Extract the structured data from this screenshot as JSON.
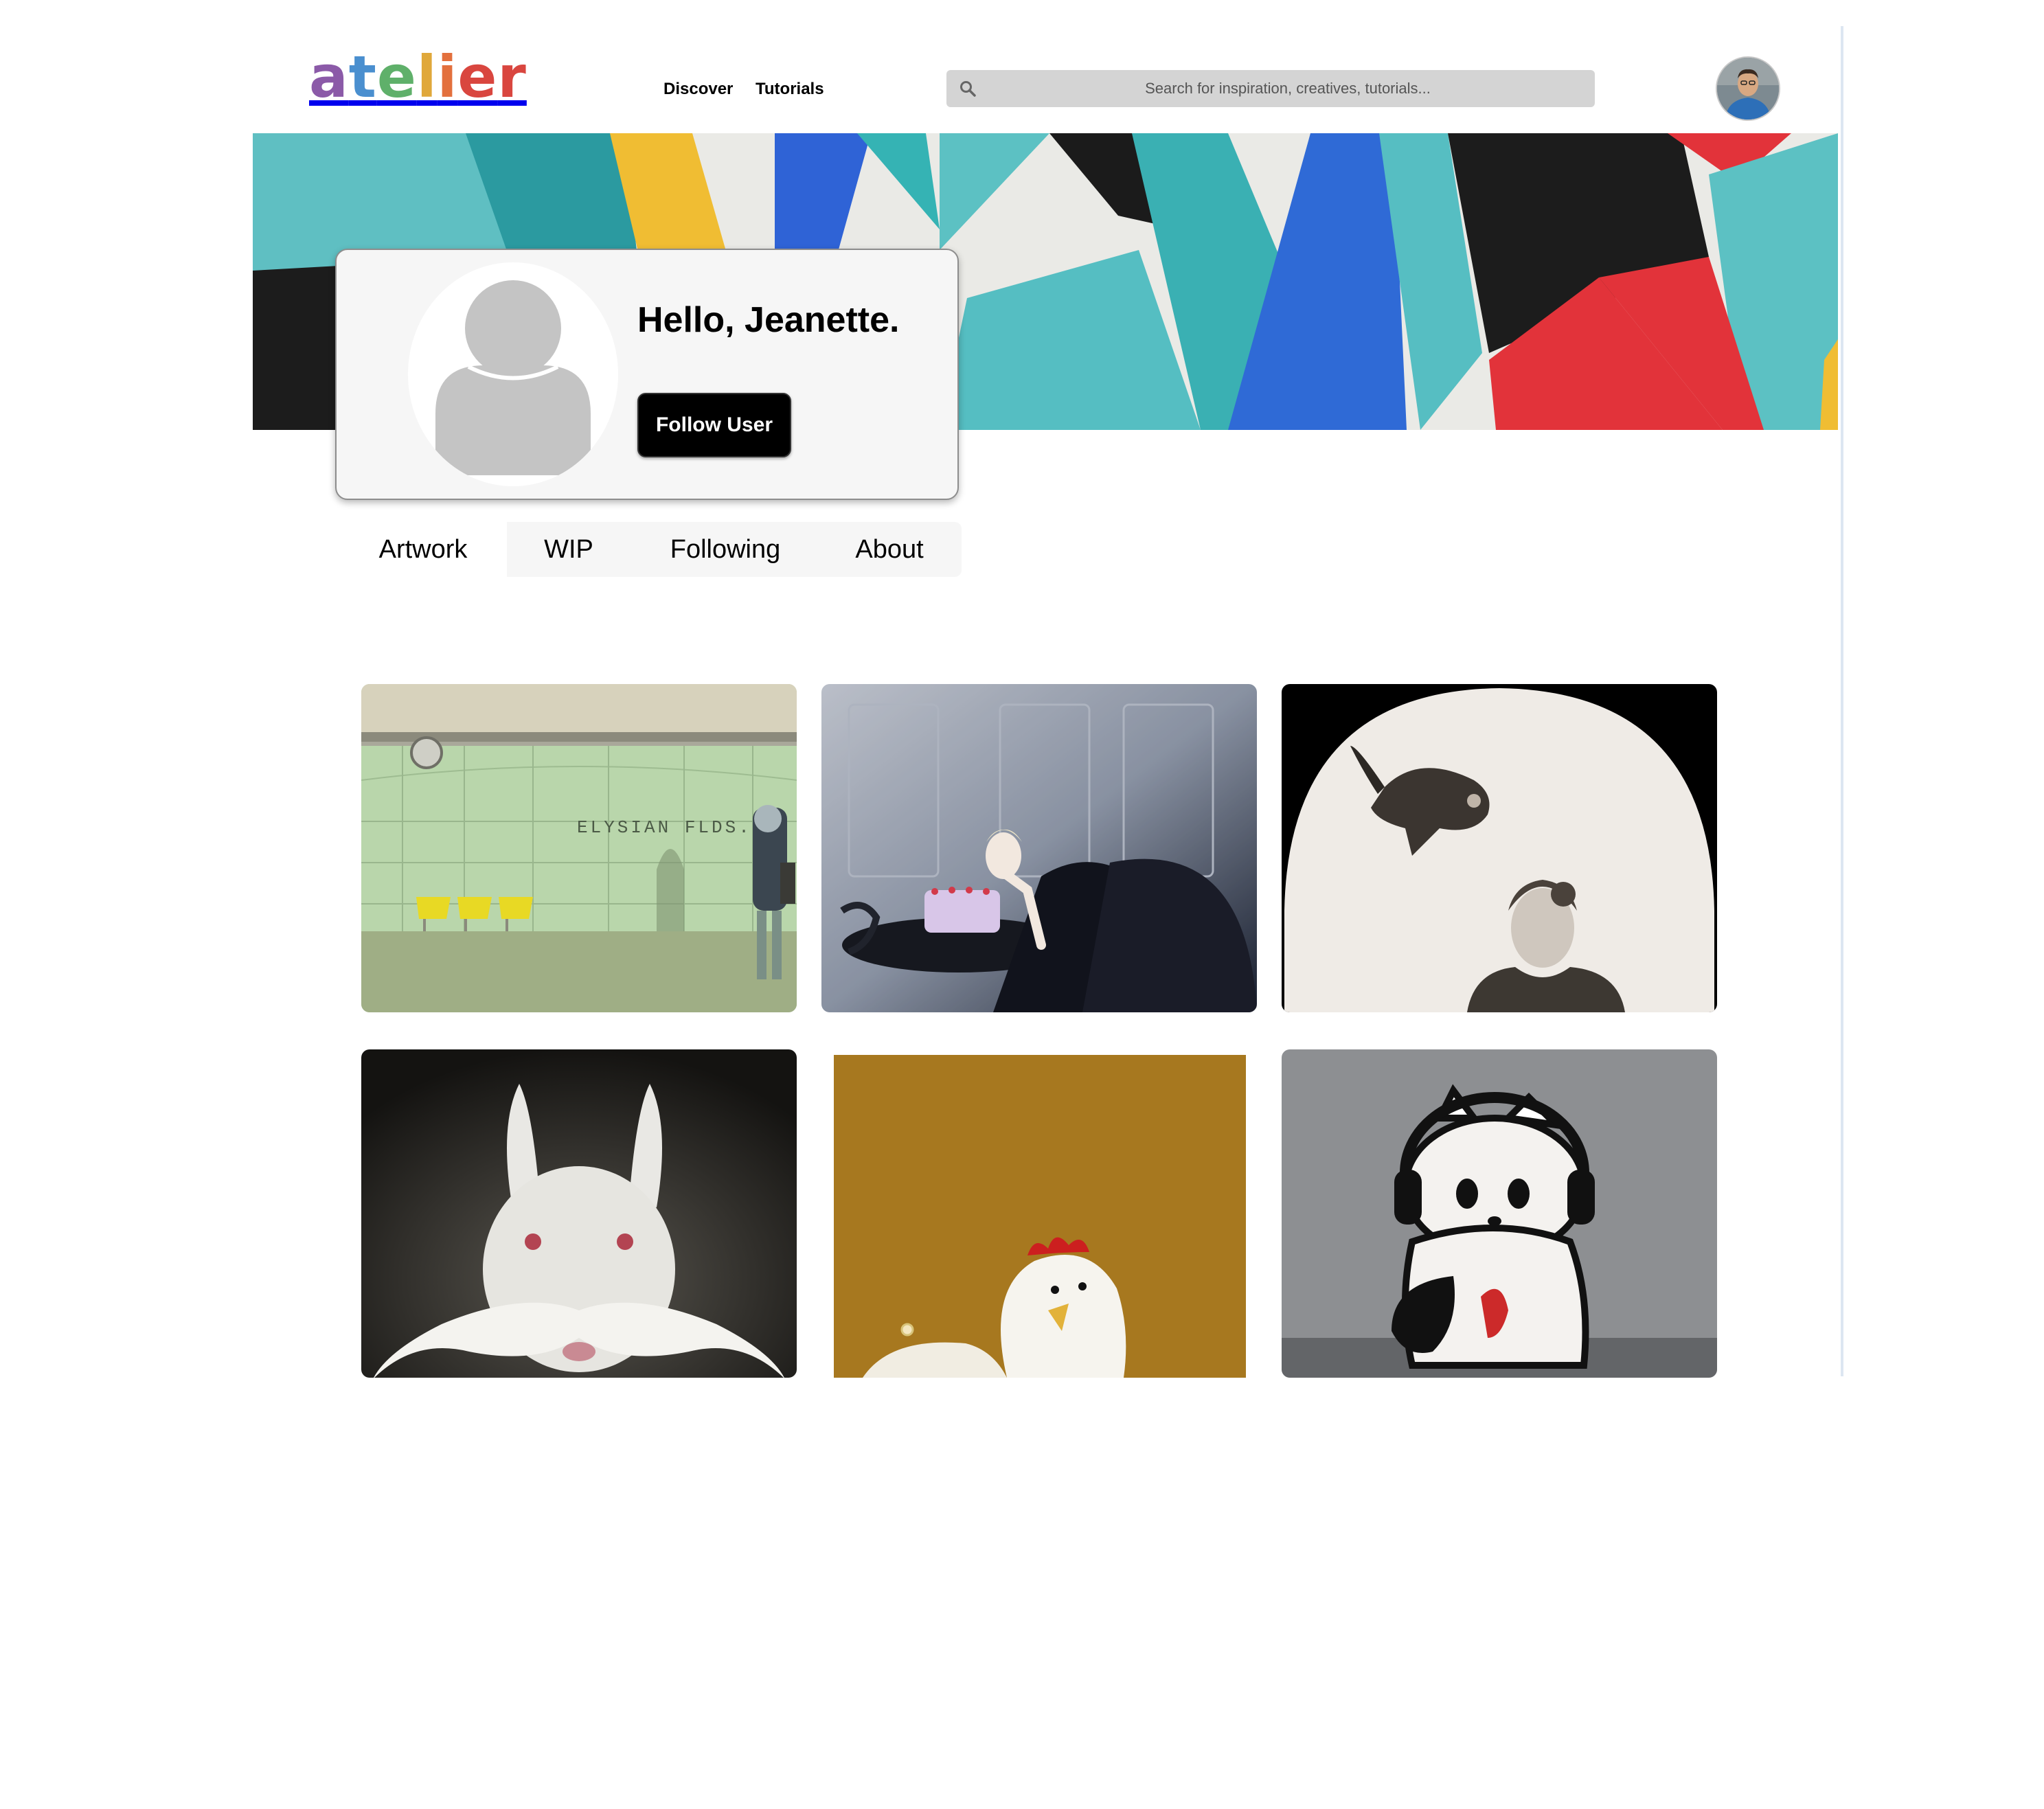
{
  "header": {
    "logo": {
      "letters": [
        "a",
        "t",
        "e",
        "l",
        "i",
        "e",
        "r"
      ]
    },
    "nav": [
      {
        "label": "Discover"
      },
      {
        "label": "Tutorials"
      }
    ],
    "search": {
      "placeholder": "Search for inspiration, creatives, tutorials..."
    }
  },
  "profile": {
    "greeting": "Hello, Jeanette.",
    "follow_label": "Follow User"
  },
  "tabs": [
    {
      "label": "Artwork"
    },
    {
      "label": "WIP"
    },
    {
      "label": "Following"
    },
    {
      "label": "About"
    }
  ],
  "artwork": {
    "subway_sign": "ELYSIAN FLDS."
  },
  "colors": {
    "brand_purple": "#8b5aa8",
    "brand_blue": "#4a8fcf",
    "brand_green": "#5fb06a",
    "brand_yellow": "#e0a83a",
    "brand_orange": "#e3703d",
    "brand_red": "#d9463f",
    "button": "#000000",
    "tab_bg": "#f6f6f6"
  },
  "icons": {
    "search": "search-icon",
    "avatar": "user-avatar",
    "profile_placeholder": "user-silhouette-icon"
  }
}
